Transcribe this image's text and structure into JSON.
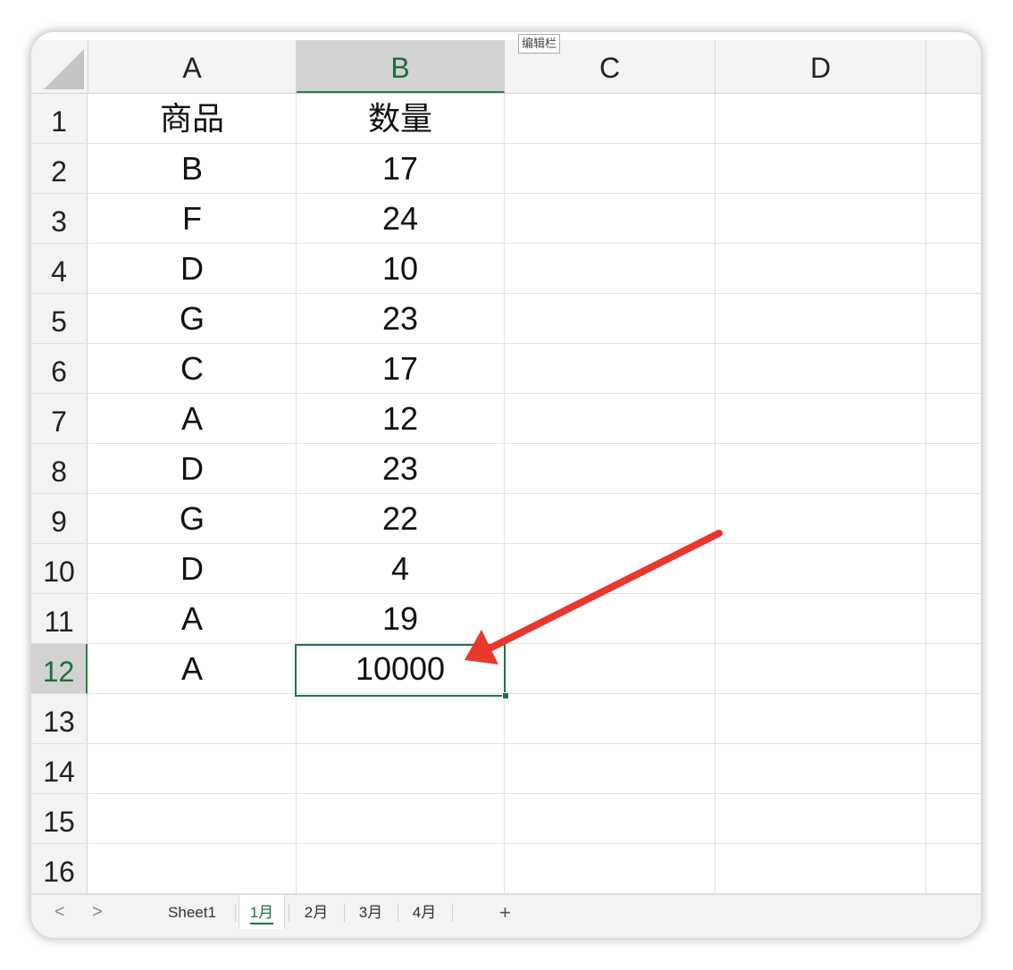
{
  "tooltip": "编辑栏",
  "columns": [
    "A",
    "B",
    "C",
    "D"
  ],
  "selected_column": "B",
  "rows": [
    "1",
    "2",
    "3",
    "4",
    "5",
    "6",
    "7",
    "8",
    "9",
    "10",
    "11",
    "12",
    "13",
    "14",
    "15",
    "16"
  ],
  "selected_row": "12",
  "table": [
    {
      "a": "商品",
      "b": "数量"
    },
    {
      "a": "B",
      "b": "17"
    },
    {
      "a": "F",
      "b": "24"
    },
    {
      "a": "D",
      "b": "10"
    },
    {
      "a": "G",
      "b": "23"
    },
    {
      "a": "C",
      "b": "17"
    },
    {
      "a": "A",
      "b": "12"
    },
    {
      "a": "D",
      "b": "23"
    },
    {
      "a": "G",
      "b": "22"
    },
    {
      "a": "D",
      "b": "4"
    },
    {
      "a": "A",
      "b": "19"
    },
    {
      "a": "A",
      "b": "10000"
    }
  ],
  "active_cell": "B12",
  "sheet_nav": {
    "prev": "<",
    "next": ">"
  },
  "sheet_tabs": [
    "Sheet1",
    "1月",
    "2月",
    "3月",
    "4月"
  ],
  "active_tab": "1月",
  "add_sheet": "+",
  "colors": {
    "accent_green": "#217346",
    "annotation_arrow": "#e8382c"
  }
}
